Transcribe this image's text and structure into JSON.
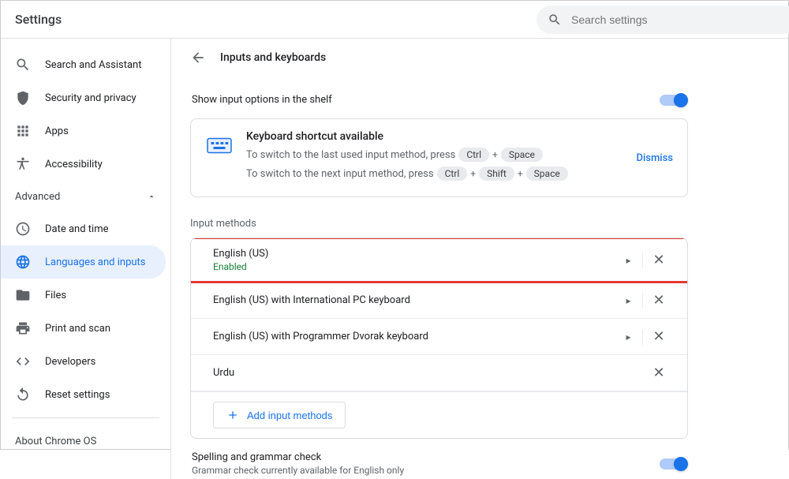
{
  "header": {
    "title": "Settings",
    "search_placeholder": "Search settings"
  },
  "sidebar": {
    "items": [
      {
        "label": "Search and Assistant",
        "icon": "search"
      },
      {
        "label": "Security and privacy",
        "icon": "shield"
      },
      {
        "label": "Apps",
        "icon": "apps"
      },
      {
        "label": "Accessibility",
        "icon": "accessibility"
      }
    ],
    "advanced_label": "Advanced",
    "advanced_items": [
      {
        "label": "Date and time",
        "icon": "clock"
      },
      {
        "label": "Languages and inputs",
        "icon": "globe",
        "active": true
      },
      {
        "label": "Files",
        "icon": "folder"
      },
      {
        "label": "Print and scan",
        "icon": "printer"
      },
      {
        "label": "Developers",
        "icon": "code"
      },
      {
        "label": "Reset settings",
        "icon": "reset"
      }
    ],
    "about_label": "About Chrome OS"
  },
  "main": {
    "title": "Inputs and keyboards",
    "shelf_option": "Show input options in the shelf",
    "shortcut": {
      "title": "Keyboard shortcut available",
      "line1_pre": "To switch to the last used input method, press",
      "line1_keys": [
        "Ctrl",
        "Space"
      ],
      "line2_pre": "To switch to the next input method, press",
      "line2_keys": [
        "Ctrl",
        "Shift",
        "Space"
      ],
      "dismiss": "Dismiss"
    },
    "input_methods_label": "Input methods",
    "input_methods": [
      {
        "name": "English (US)",
        "status": "Enabled",
        "caret": true,
        "close": true,
        "highlighted": true
      },
      {
        "name": "English (US) with International PC keyboard",
        "caret": true,
        "close": true
      },
      {
        "name": "English (US) with Programmer Dvorak keyboard",
        "caret": true,
        "close": true
      },
      {
        "name": "Urdu",
        "caret": false,
        "close": true
      }
    ],
    "add_button": "Add input methods",
    "spell": {
      "title": "Spelling and grammar check",
      "sub": "Grammar check currently available for English only"
    }
  }
}
